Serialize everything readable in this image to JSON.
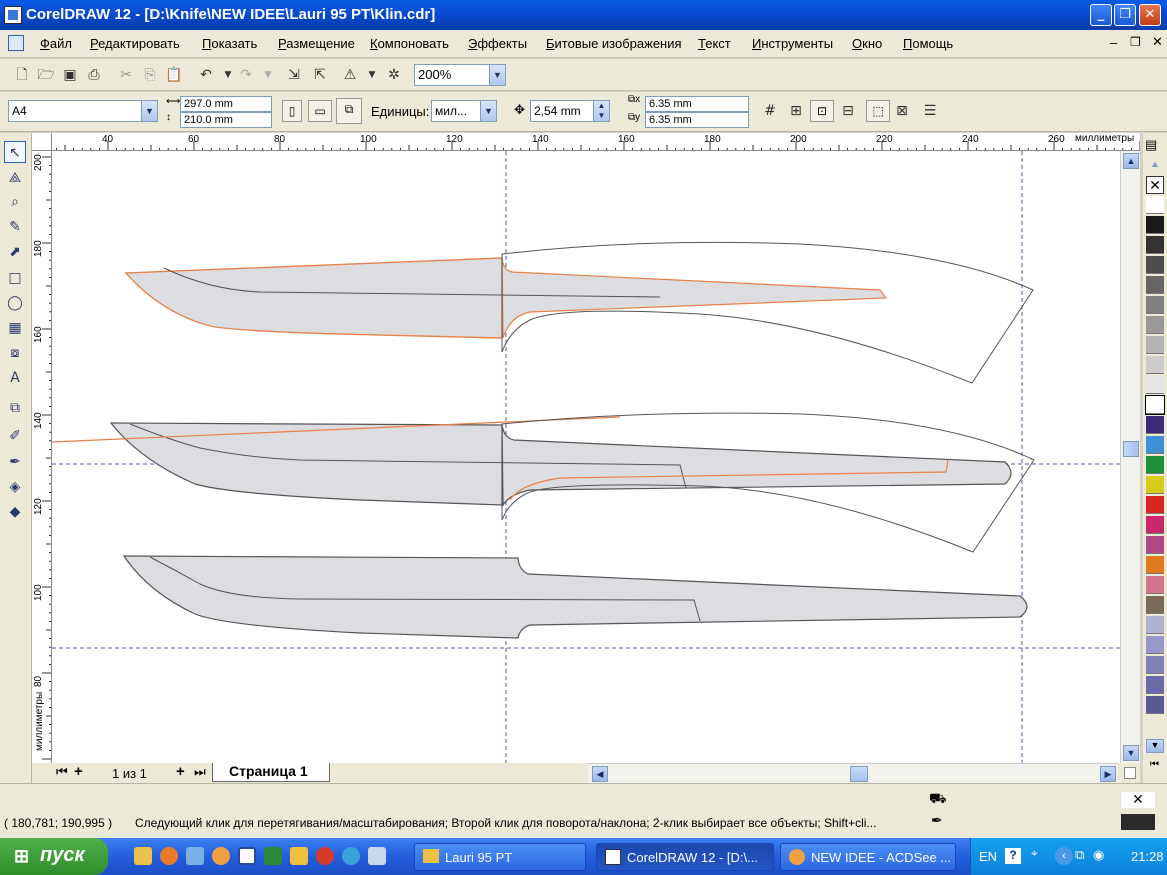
{
  "window": {
    "title": "CorelDRAW 12 - [D:\\Knife\\NEW IDEE\\Lauri 95 PT\\Klin.cdr]",
    "buttons": [
      "minimize",
      "maximize",
      "close"
    ]
  },
  "menu": [
    {
      "label": "Файл"
    },
    {
      "label": "Редактировать"
    },
    {
      "label": "Показать"
    },
    {
      "label": "Размещение"
    },
    {
      "label": "Компоновать"
    },
    {
      "label": "Эффекты"
    },
    {
      "label": "Битовые изображения"
    },
    {
      "label": "Текст"
    },
    {
      "label": "Инструменты"
    },
    {
      "label": "Окно"
    },
    {
      "label": "Помощь"
    }
  ],
  "toolbar": {
    "zoom": "200%"
  },
  "property_bar": {
    "paper_size": "A4",
    "width": "297.0 mm",
    "height": "210.0 mm",
    "units_label": "Единицы:",
    "units_value": "мил...",
    "nudge": "2,54 mm",
    "dup_x": "6.35 mm",
    "dup_y": "6.35 mm"
  },
  "ruler": {
    "horizontal_labels": [
      "40",
      "60",
      "80",
      "100",
      "120",
      "140",
      "160",
      "180",
      "200",
      "220",
      "240",
      "260"
    ],
    "horizontal_unit": "миллиметры",
    "vertical_labels": [
      "200",
      "180",
      "160",
      "140",
      "120",
      "100",
      "80"
    ],
    "vertical_unit": "миллиметры"
  },
  "page_nav": {
    "counter": "1 из 1",
    "tab": "Страница 1"
  },
  "status": {
    "coords": "( 180,781; 190,995 )",
    "message": "Следующий клик для перетягивания/масштабирования; Второй клик для поворота/наклона; 2-клик выбирает все объекты; Shift+cli..."
  },
  "palette_colors": [
    "#ffffff",
    "#1a1a1a",
    "#333333",
    "#4d4d4d",
    "#666666",
    "#808080",
    "#999999",
    "#b3b3b3",
    "#cccccc",
    "#e6e6e6",
    "#ffffff",
    "#3a2a7a",
    "#3d8fd6",
    "#1e8f3a",
    "#d6cc1a",
    "#d6261e",
    "#c8286a",
    "#b04a86",
    "#e07a1e",
    "#d27690",
    "#7a6a5a",
    "#b0b0d0",
    "#9898c8",
    "#8080b8",
    "#6a6aa8",
    "#5a5a98"
  ],
  "taskbar": {
    "start": "пуск",
    "items": [
      {
        "label": "Lauri 95 PT",
        "active": false
      },
      {
        "label": "CorelDRAW 12 - [D:\\...",
        "active": true
      },
      {
        "label": "NEW IDEE - ACDSee ...",
        "active": false
      }
    ],
    "lang": "EN",
    "clock": "21:28"
  },
  "colors": {
    "outline_orange": "#e8804a",
    "blade_fill": "#dcdde0",
    "guideline": "#5a4fa8"
  }
}
